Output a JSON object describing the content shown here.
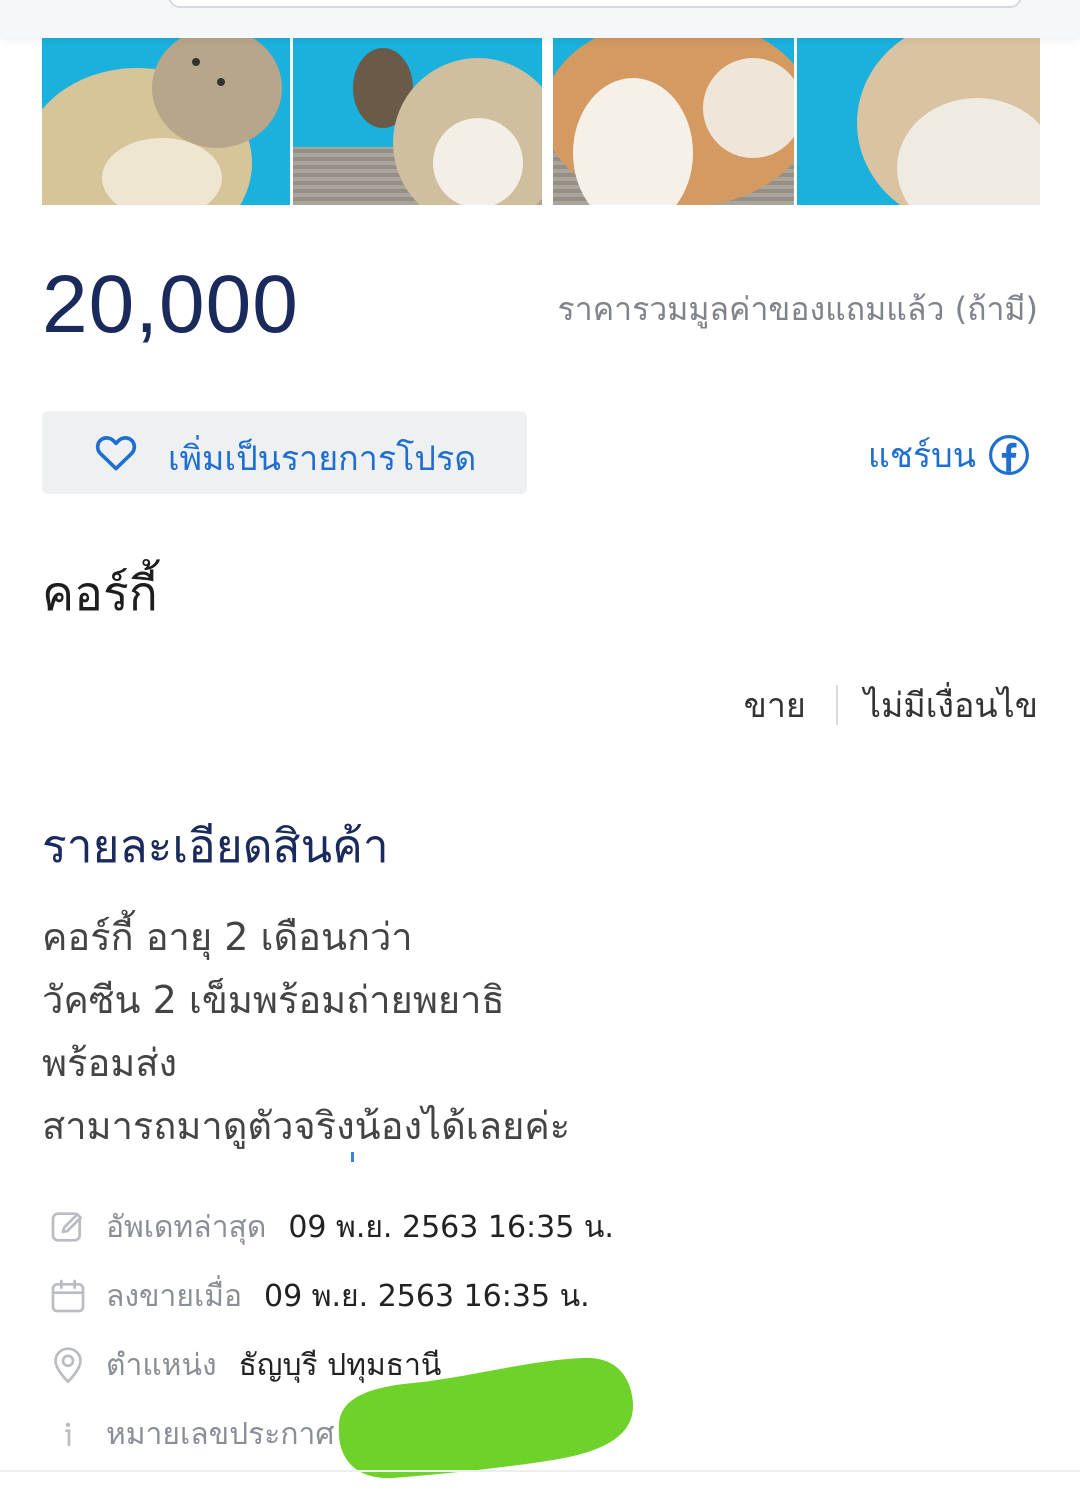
{
  "listing": {
    "price": "20,000",
    "price_note": "ราคารวมมูลค่าของแถมแล้ว (ถ้ามี)",
    "favorite_label": "เพิ่มเป็นรายการโปรด",
    "share_label": "แชร์บน",
    "title": "คอร์กี้",
    "tags": [
      "ขาย",
      "ไม่มีเงื่อนไข"
    ],
    "details_heading": "รายละเอียดสินค้า",
    "description_lines": [
      "คอร์กี้ อายุ 2 เดือนกว่า",
      "วัคซีน 2 เข็มพร้อมถ่ายพยาธิ",
      "พร้อมส่ง",
      "สามารถมาดูตัวจริงน้องได้เลยค่ะ"
    ]
  },
  "meta": {
    "updated_label": "อัพเดทล่าสุด",
    "updated_value": "09 พ.ย. 2563 16:35 น.",
    "posted_label": "ลงขายเมื่อ",
    "posted_value": "09 พ.ย. 2563 16:35 น.",
    "location_label": "ตำแหน่ง",
    "location_value": "ธัญบุรี ปทุมธานี",
    "listing_id_label": "หมายเลขประกาศ"
  },
  "icons": {
    "favorite": "heart-icon",
    "share": "facebook-icon",
    "updated": "edit-icon",
    "posted": "calendar-icon",
    "location": "location-pin-icon",
    "listing_id": "info-icon"
  },
  "colors": {
    "price": "#1a2a5c",
    "accent": "#1f6fd1",
    "muted": "#8a8e96",
    "redaction": "#6fd22a"
  }
}
